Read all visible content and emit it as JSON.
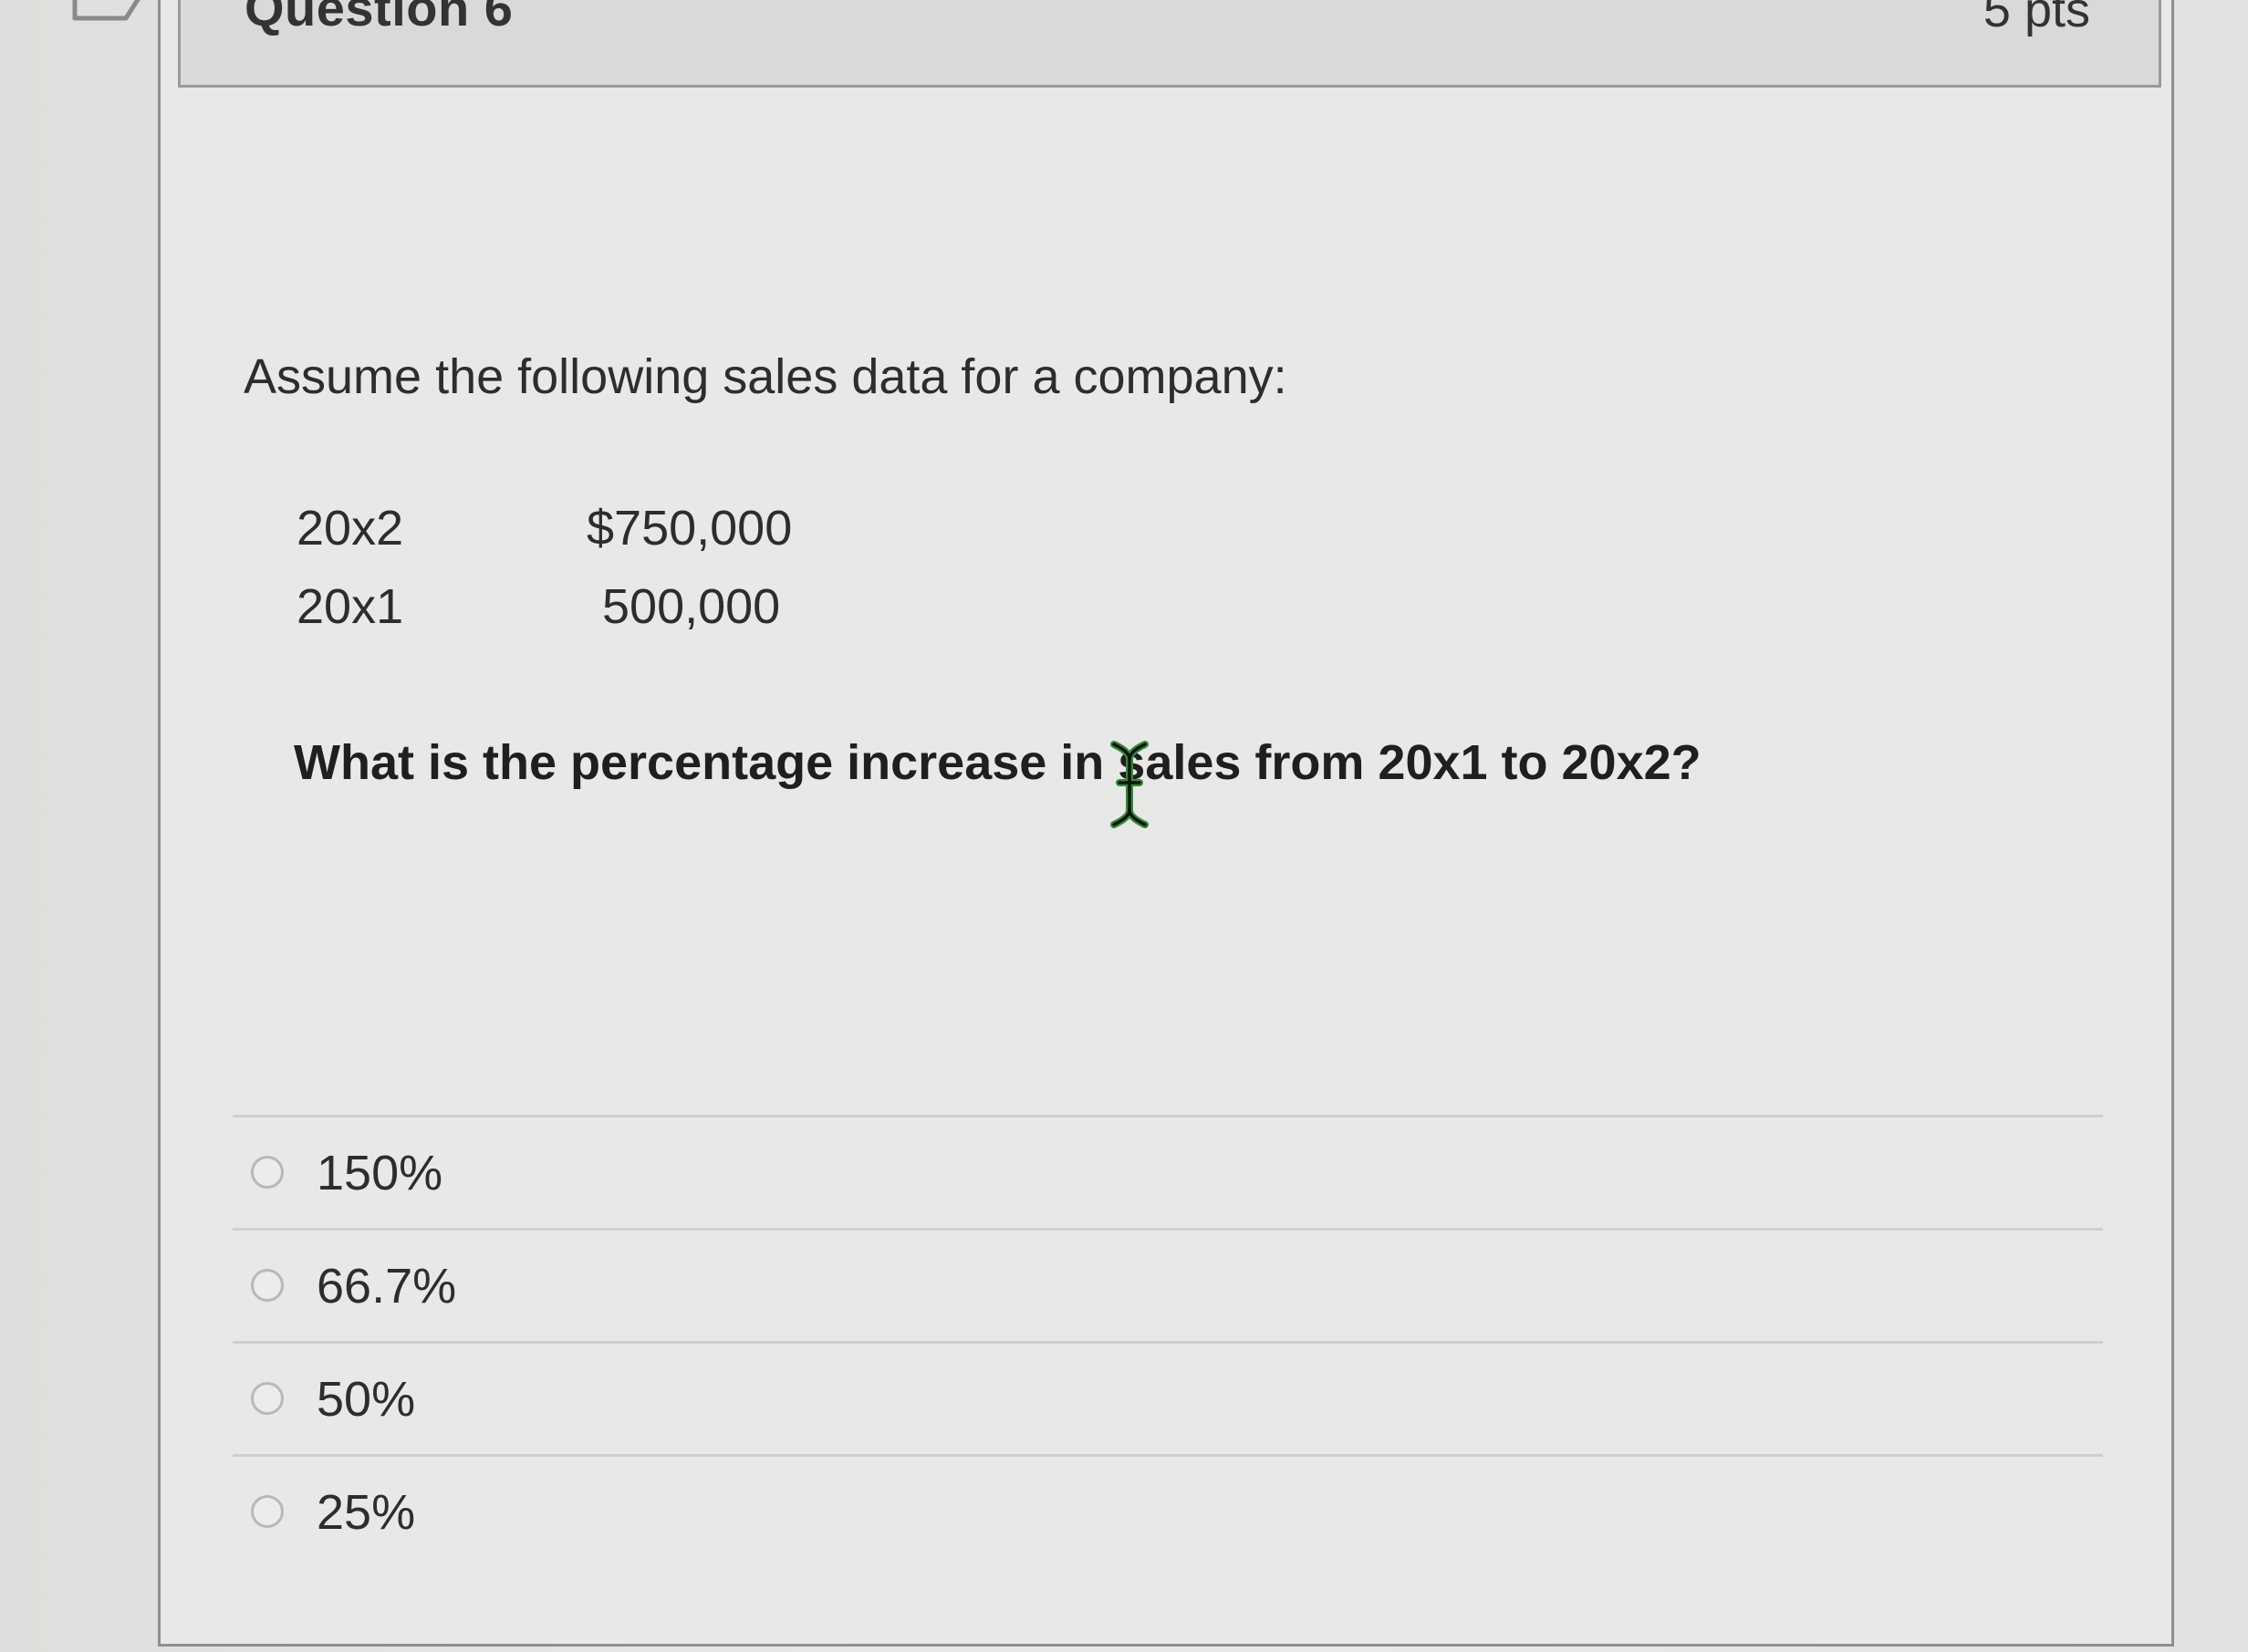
{
  "question": {
    "title": "Question 6",
    "points": "5 pts",
    "intro": "Assume the following sales data for a company:",
    "sales": [
      {
        "year": "20x2",
        "amount": "$750,000"
      },
      {
        "year": "20x1",
        "amount": "500,000"
      }
    ],
    "prompt": "What is the percentage increase in sales from 20x1 to 20x2?",
    "answers": [
      {
        "label": "150%"
      },
      {
        "label": "66.7%"
      },
      {
        "label": "50%"
      },
      {
        "label": "25%"
      }
    ]
  },
  "colors": {
    "background": "#e3e3e1",
    "header_bg": "#d9d9d7",
    "text": "#2d2d2d",
    "cursor_green": "#2f8f2f"
  },
  "icons": {
    "flag": "flag-icon",
    "cursor": "text-cursor-icon",
    "radio": "radio-button-icon"
  }
}
